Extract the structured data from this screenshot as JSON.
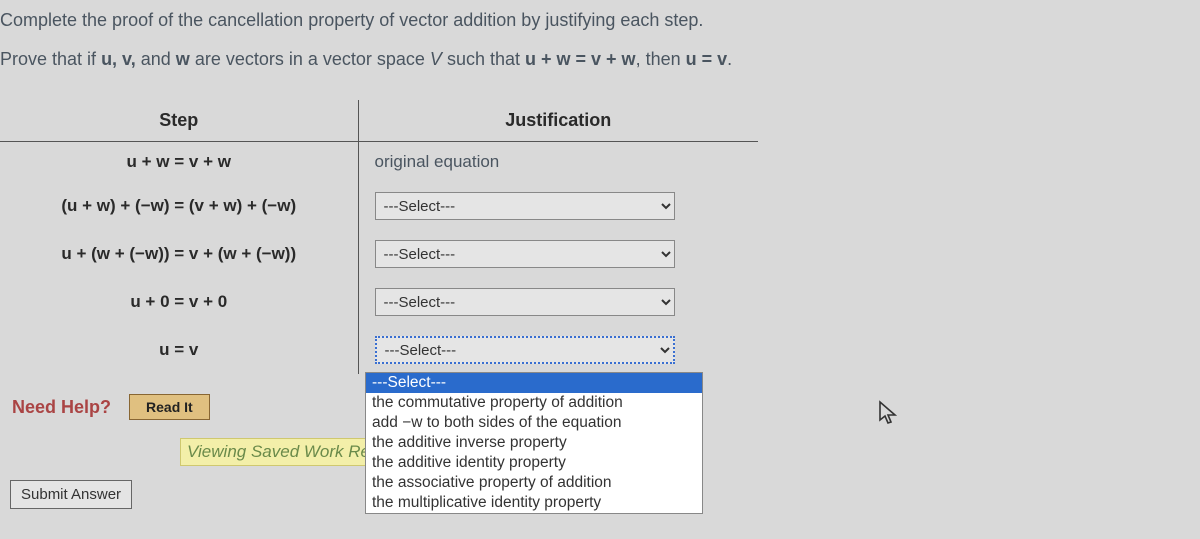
{
  "question": "Complete the proof of the cancellation property of vector addition by justifying each step.",
  "prove_prefix": "Prove that if ",
  "prove_vectors": "u, v,",
  "prove_mid1": " and ",
  "prove_w": "w",
  "prove_mid2": " are vectors in a vector space ",
  "prove_V": "V",
  "prove_mid3": " such that ",
  "prove_eq1": "u + w = v + w",
  "prove_mid4": ", then ",
  "prove_eq2": "u = v",
  "prove_end": ".",
  "headers": {
    "step": "Step",
    "justification": "Justification"
  },
  "rows": [
    {
      "step": "u + w = v + w",
      "just_text": "original equation"
    },
    {
      "step": "(u + w) + (−w) = (v + w) + (−w)",
      "just_select": "---Select---"
    },
    {
      "step": "u + (w + (−w)) = v + (w + (−w))",
      "just_select": "---Select---"
    },
    {
      "step": "u + 0 = v + 0",
      "just_select": "---Select---"
    },
    {
      "step": "u = v",
      "just_select": "---Select---"
    }
  ],
  "dropdown_open": {
    "options": [
      "---Select---",
      "the commutative property of addition",
      "add −w to both sides of the equation",
      "the additive inverse property",
      "the additive identity property",
      "the associative property of addition",
      "the multiplicative identity property"
    ],
    "selected_index": 0
  },
  "need_help": "Need Help?",
  "read_it": "Read It",
  "saved_work": "Viewing Saved Work Rev",
  "submit": "Submit Answer"
}
